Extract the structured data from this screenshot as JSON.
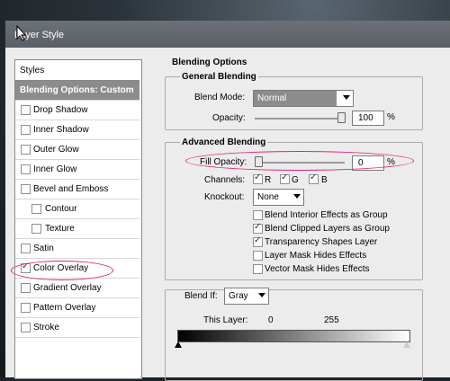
{
  "window": {
    "title": "Layer Style"
  },
  "styles_panel": {
    "header": "Styles",
    "items": [
      {
        "label": "Blending Options: Custom",
        "selected": true,
        "checkbox": false
      },
      {
        "label": "Drop Shadow",
        "checked": false
      },
      {
        "label": "Inner Shadow",
        "checked": false
      },
      {
        "label": "Outer Glow",
        "checked": false
      },
      {
        "label": "Inner Glow",
        "checked": false
      },
      {
        "label": "Bevel and Emboss",
        "checked": false
      },
      {
        "label": "Contour",
        "checked": false,
        "sub": true
      },
      {
        "label": "Texture",
        "checked": false,
        "sub": true
      },
      {
        "label": "Satin",
        "checked": false
      },
      {
        "label": "Color Overlay",
        "checked": true
      },
      {
        "label": "Gradient Overlay",
        "checked": false
      },
      {
        "label": "Pattern Overlay",
        "checked": false
      },
      {
        "label": "Stroke",
        "checked": false
      }
    ]
  },
  "blending_options": {
    "title": "Blending Options",
    "general": {
      "title": "General Blending",
      "blend_mode_label": "Blend Mode:",
      "blend_mode_value": "Normal",
      "opacity_label": "Opacity:",
      "opacity_value": "100",
      "opacity_unit": "%",
      "opacity_fraction": 1.0
    },
    "advanced": {
      "title": "Advanced Blending",
      "fill_opacity_label": "Fill Opacity:",
      "fill_opacity_value": "0",
      "fill_opacity_unit": "%",
      "fill_opacity_fraction": 0.0,
      "channels_label": "Channels:",
      "channels": [
        {
          "label": "R",
          "checked": true
        },
        {
          "label": "G",
          "checked": true
        },
        {
          "label": "B",
          "checked": true
        }
      ],
      "knockout_label": "Knockout:",
      "knockout_value": "None",
      "options": [
        {
          "label": "Blend Interior Effects as Group",
          "checked": false
        },
        {
          "label": "Blend Clipped Layers as Group",
          "checked": true
        },
        {
          "label": "Transparency Shapes Layer",
          "checked": true
        },
        {
          "label": "Layer Mask Hides Effects",
          "checked": false
        },
        {
          "label": "Vector Mask Hides Effects",
          "checked": false
        }
      ]
    },
    "blend_if": {
      "label": "Blend If:",
      "value": "Gray",
      "this_layer_label": "This Layer:",
      "low": "0",
      "high": "255"
    }
  },
  "colors": {
    "highlight_oval": "#e0207a",
    "selected_item_bg": "#8c8c8c"
  }
}
